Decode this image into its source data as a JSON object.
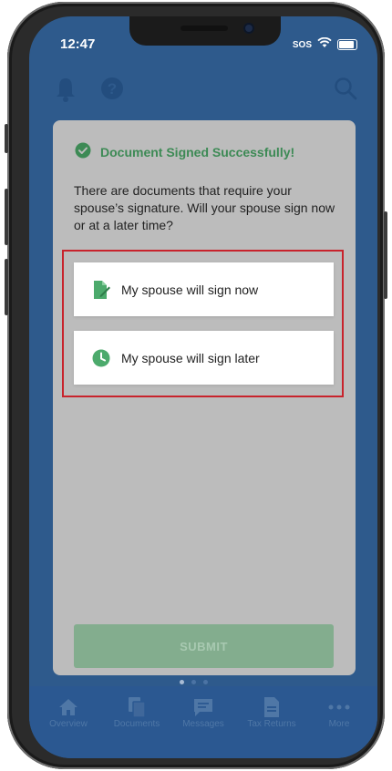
{
  "status_bar": {
    "time": "12:47",
    "sos": "SOS"
  },
  "appbar": {
    "icons": [
      "bell-icon",
      "help-icon",
      "search-icon"
    ]
  },
  "modal": {
    "success_title": "Document Signed Successfully!",
    "question": "There are documents that require your spouse’s signature. Will your spouse sign now or at a later time?",
    "options": [
      {
        "label": "My spouse will sign now",
        "icon": "document-sign-icon"
      },
      {
        "label": "My spouse will sign later",
        "icon": "clock-icon"
      }
    ],
    "submit_label": "SUBMIT"
  },
  "tabs": [
    {
      "label": "Overview",
      "icon": "home-icon"
    },
    {
      "label": "Documents",
      "icon": "documents-icon"
    },
    {
      "label": "Messages",
      "icon": "message-icon"
    },
    {
      "label": "Tax Returns",
      "icon": "tax-return-icon"
    },
    {
      "label": "More",
      "icon": "more-icon"
    }
  ],
  "colors": {
    "success": "#3d8a55",
    "highlight": "#c8232c",
    "submit_bg": "#83ad8e",
    "app_blue": "#2e5a8c"
  }
}
